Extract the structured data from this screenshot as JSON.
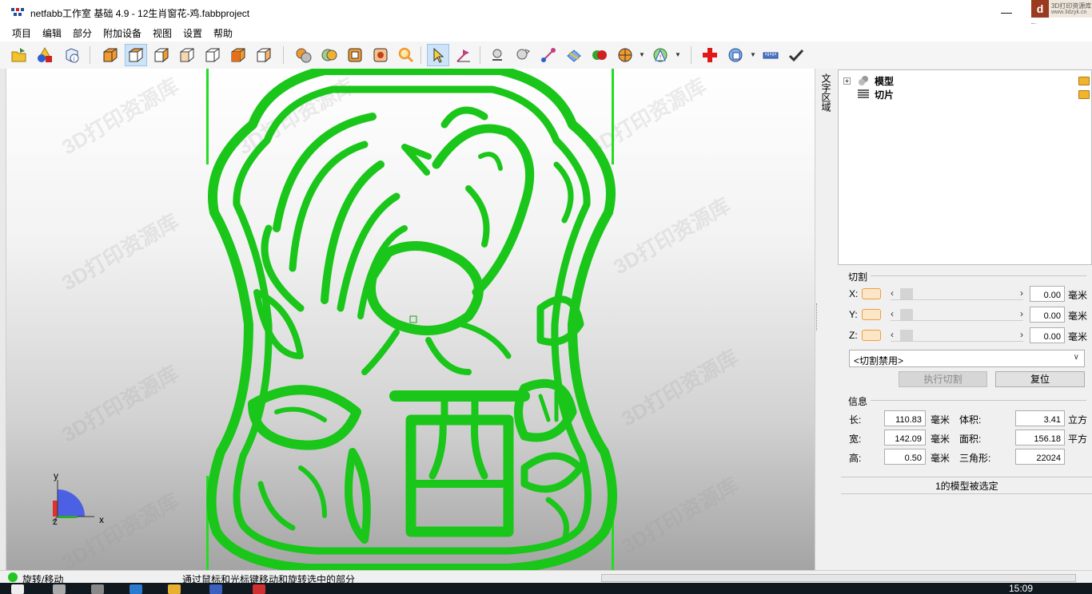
{
  "window": {
    "title": "netfabb工作室 基础 4.9 - 12生肖窗花-鸡.fabbproject",
    "minimize": "—"
  },
  "brand": {
    "logo": "d",
    "line1": "3D打印资源库",
    "line2": "www.3dzyk.cn"
  },
  "menu": [
    "项目",
    "编辑",
    "部分",
    "附加设备",
    "视图",
    "设置",
    "帮助"
  ],
  "viewport": {
    "watermark": "3D打印资源库",
    "axes": {
      "y": "y",
      "z": "z",
      "x": "x"
    }
  },
  "side_tab": "文字区域",
  "tree": [
    {
      "label": "模型",
      "icon": "model-icon"
    },
    {
      "label": "切片",
      "icon": "slice-icon"
    }
  ],
  "cut": {
    "title": "切割",
    "rows": [
      {
        "axis": "X:",
        "value": "0.00",
        "unit": "毫米"
      },
      {
        "axis": "Y:",
        "value": "0.00",
        "unit": "毫米"
      },
      {
        "axis": "Z:",
        "value": "0.00",
        "unit": "毫米"
      }
    ],
    "mode": "<切割禁用>",
    "execute": "执行切割",
    "reset": "复位"
  },
  "info": {
    "title": "信息",
    "length_label": "长:",
    "length": "110.83",
    "length_unit": "毫米",
    "width_label": "宽:",
    "width": "142.09",
    "width_unit": "毫米",
    "height_label": "高:",
    "height": "0.50",
    "height_unit": "毫米",
    "volume_label": "体积:",
    "volume": "3.41",
    "volume_unit": "立方",
    "area_label": "面积:",
    "area": "156.18",
    "area_unit": "平方",
    "tri_label": "三角形:",
    "tri": "22024",
    "selection": "1的模型被选定"
  },
  "status": {
    "mode": "旋转/移动",
    "hint": "通过鼠标和光标键移动和旋转选中的部分"
  },
  "taskbar": {
    "time": "15:09"
  }
}
